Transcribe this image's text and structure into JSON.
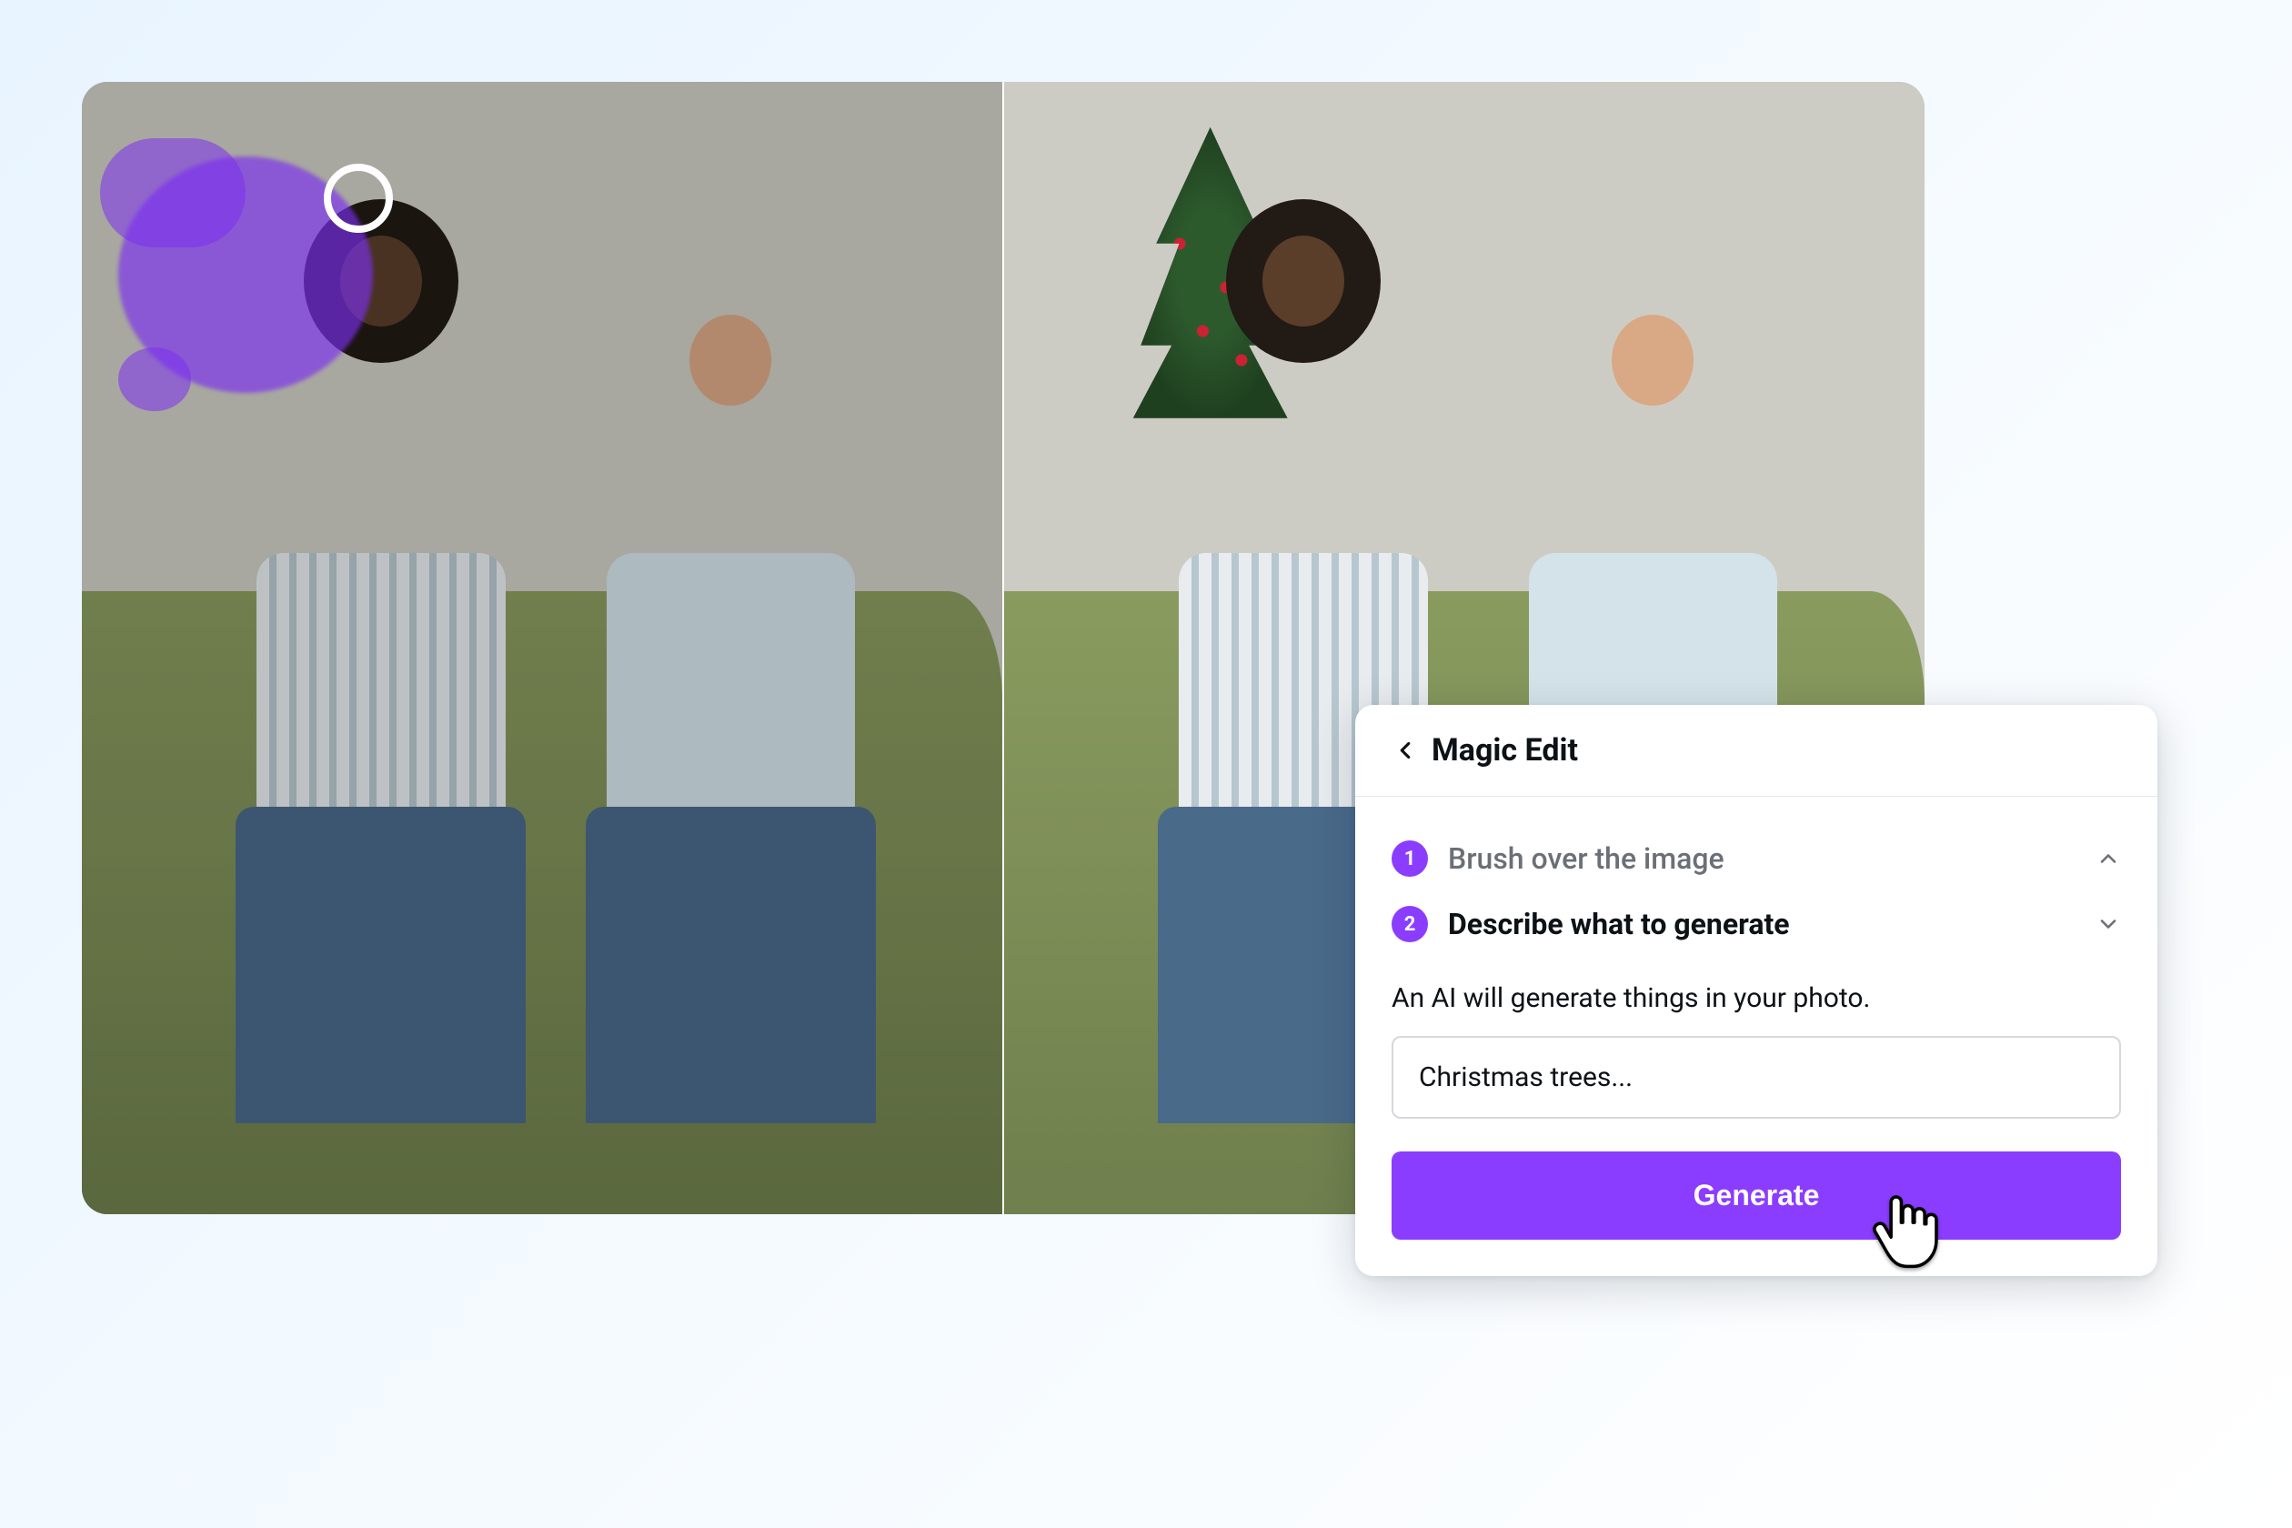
{
  "panel": {
    "title": "Magic Edit",
    "steps": [
      {
        "num": "1",
        "label": "Brush over the image"
      },
      {
        "num": "2",
        "label": "Describe what to generate"
      }
    ],
    "description": "An AI will generate things in your photo.",
    "prompt_value": "Christmas trees...",
    "generate_label": "Generate"
  },
  "colors": {
    "accent": "#8b3dff"
  }
}
